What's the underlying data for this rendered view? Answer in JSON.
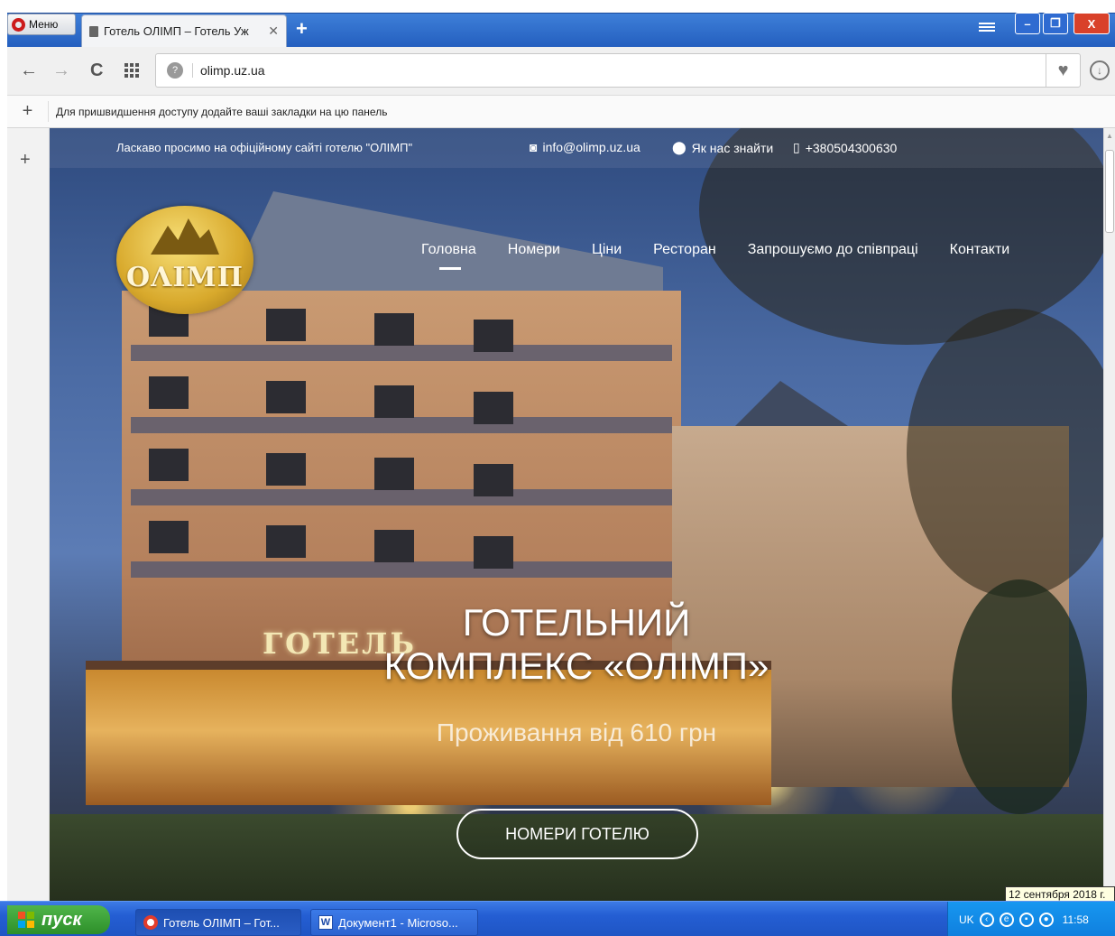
{
  "browser": {
    "menu_label": "Меню",
    "tab_title": "Готель ОЛІМП – Готель Уж",
    "tab_close": "✕",
    "new_tab": "+",
    "url": "olimp.uz.ua",
    "window_controls": {
      "minimize": "–",
      "maximize": "❐",
      "close": "X"
    },
    "nav": {
      "back": "←",
      "forward": "→",
      "reload": "C"
    },
    "bookmarks_hint": "Для пришвидшення доступу додайте ваші закладки на цю панель",
    "bookmarks_add": "+",
    "sidebar_add": "+",
    "icons": [
      "opera-logo-icon",
      "page-icon",
      "speed-dial-icon",
      "site-info-icon",
      "heart-icon",
      "download-icon"
    ]
  },
  "site": {
    "welcome": "Ласкаво просимо на офіційному сайті готелю \"ОЛІМП\"",
    "contacts": {
      "email": "info@olimp.uz.ua",
      "map": "Як нас знайти",
      "phone": "+380504300630"
    },
    "logo_text": "ΟΛΙΜΠ",
    "nav": [
      {
        "label": "Головна",
        "active": true
      },
      {
        "label": "Номери"
      },
      {
        "label": "Ціни"
      },
      {
        "label": "Ресторан"
      },
      {
        "label": "Запрошуємо до співпраці"
      },
      {
        "label": "Контакти"
      }
    ],
    "building_sign": "ГОТЕЛЬ",
    "hero": {
      "title_line1": "ГОТЕЛЬНИЙ",
      "title_line2": "КОМПЛЕКС «ОЛІМП»",
      "subtitle": "Проживання від 610 грн",
      "button": "НОМЕРИ ГОТЕЛЮ"
    }
  },
  "taskbar": {
    "start_label": "пуск",
    "tasks": [
      {
        "label": "Готель ОЛІМП – Гот..."
      },
      {
        "label": "Документ1 - Microso..."
      }
    ],
    "word_icon_letter": "W",
    "tray_lang": "UK",
    "clock": "11:58",
    "date_tooltip": "12 сентября 2018 г."
  },
  "colors": {
    "titlebar": "#2f6bd1",
    "taskbar": "#245ed3",
    "start_button": "#2d8f2a",
    "tray": "#0f7fde",
    "hero_text": "#ffffff"
  }
}
